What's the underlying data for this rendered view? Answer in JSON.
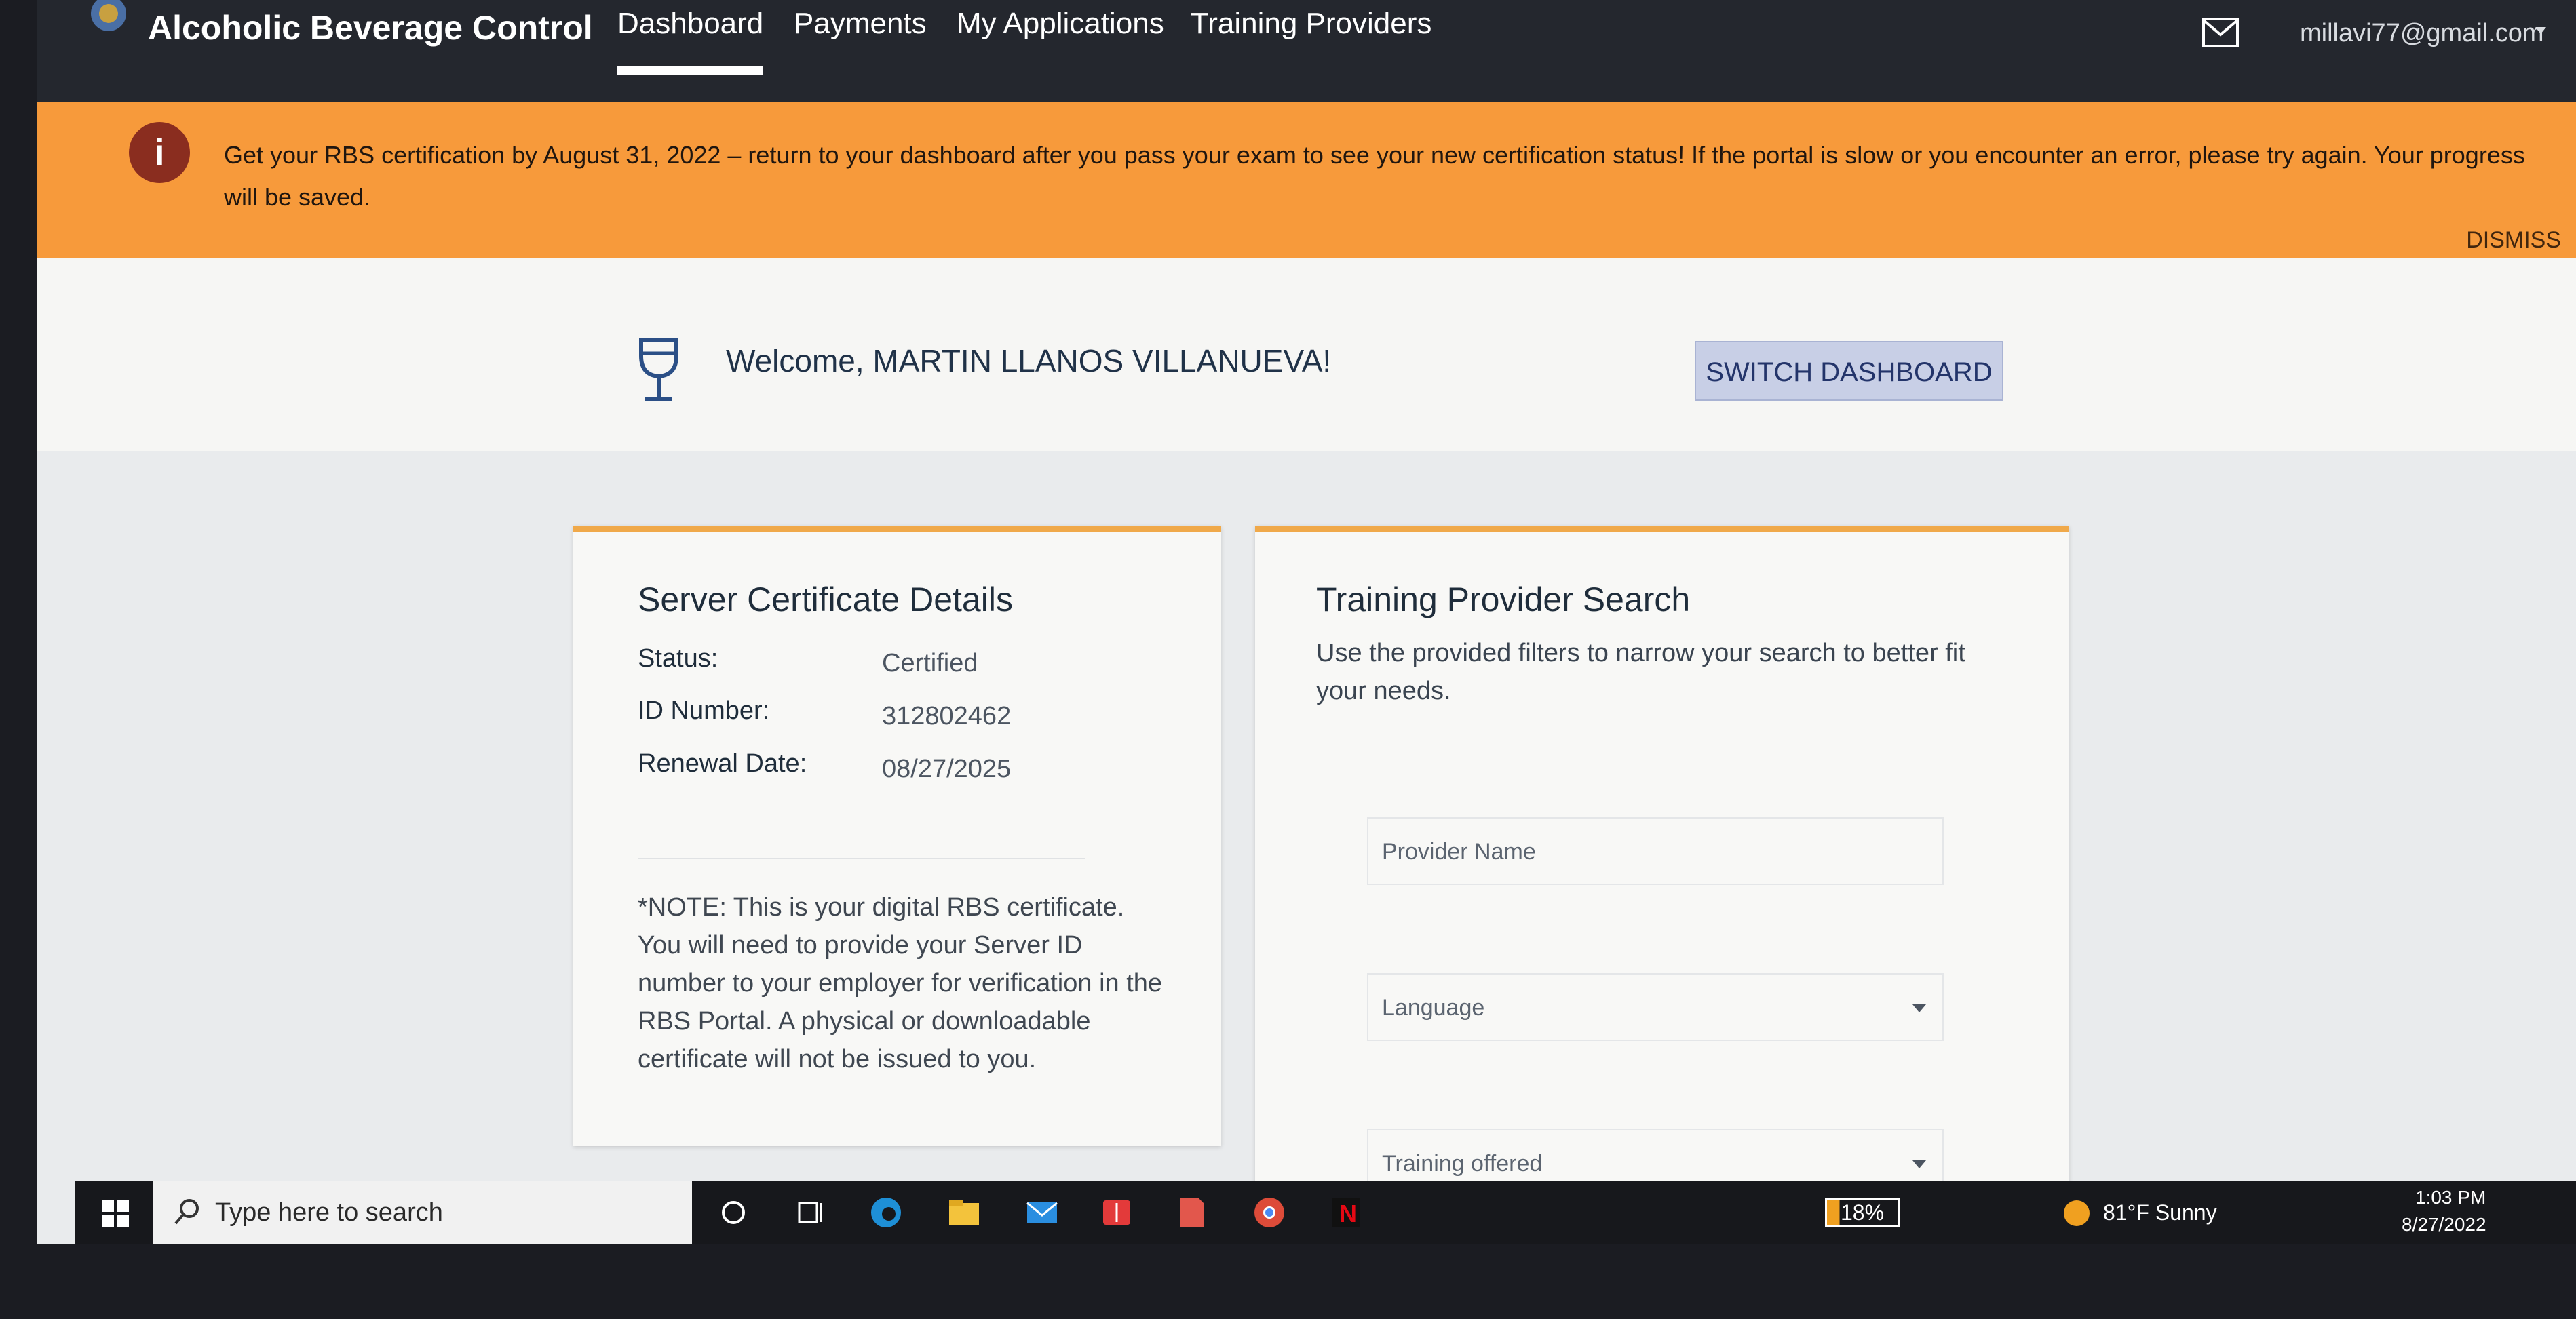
{
  "header": {
    "brand_title": "Alcoholic Beverage Control",
    "tabs": [
      "Dashboard",
      "Payments",
      "My Applications",
      "Training Providers"
    ],
    "active_tab": "Dashboard",
    "user_email": "millavi77@gmail.com"
  },
  "banner": {
    "message": "Get your RBS certification by August 31, 2022 – return to your dashboard after you pass your exam to see your new certification status! If the portal is slow or you encounter an error, please try again. Your progress will be saved.",
    "dismiss": "DISMISS"
  },
  "welcome": {
    "text": "Welcome, MARTIN LLANOS VILLANUEVA!",
    "switch_button": "SWITCH DASHBOARD"
  },
  "certificate": {
    "title": "Server Certificate Details",
    "status_label": "Status:",
    "status_value": "Certified",
    "id_label": "ID Number:",
    "id_value": "312802462",
    "renewal_label": "Renewal Date:",
    "renewal_value": "08/27/2025",
    "note": "*NOTE: This is your digital RBS certificate. You will need to provide your Server ID number to your employer for verification in the RBS Portal. A physical or downloadable certificate will not be issued to you."
  },
  "provider_search": {
    "title": "Training Provider Search",
    "description": "Use the provided filters to narrow your search to better fit your needs.",
    "provider_name_label": "Provider Name",
    "language_label": "Language",
    "training_offered_label": "Training offered"
  },
  "taskbar": {
    "search_placeholder": "Type here to search",
    "battery": "18%",
    "weather": "81°F  Sunny",
    "time": "1:03 PM",
    "date": "8/27/2022"
  },
  "colors": {
    "banner": "#f79a3b",
    "card_accent": "#f0a94a",
    "nav_bg": "#24272e"
  }
}
